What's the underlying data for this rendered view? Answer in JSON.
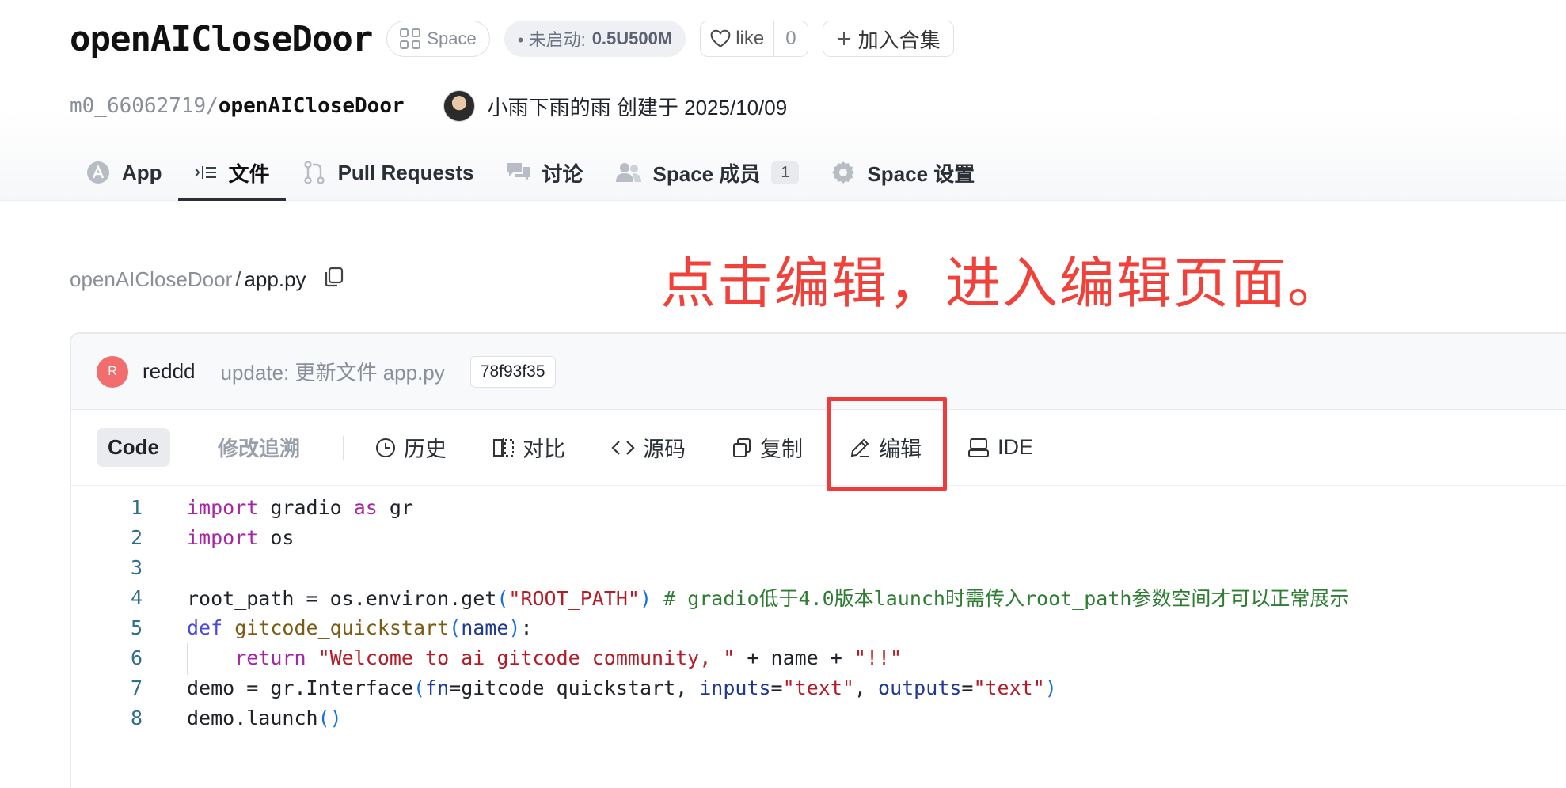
{
  "header": {
    "title": "openAICloseDoor",
    "space_label": "Space",
    "status_prefix": "• 未启动: ",
    "status_value": "0.5U500M",
    "like_label": "like",
    "like_count": "0",
    "collect_label": "加入合集",
    "owner": "m0_66062719/",
    "repo_name": "openAICloseDoor",
    "creator_text": "小雨下雨的雨 创建于 2025/10/09"
  },
  "tabs": [
    {
      "label": "App",
      "icon": "app-icon"
    },
    {
      "label": "文件",
      "icon": "files-icon"
    },
    {
      "label": "Pull Requests",
      "icon": "pull-request-icon"
    },
    {
      "label": "讨论",
      "icon": "discussion-icon"
    },
    {
      "label": "Space 成员",
      "icon": "members-icon",
      "count": "1"
    },
    {
      "label": "Space 设置",
      "icon": "settings-gear-icon"
    }
  ],
  "path": {
    "dir": "openAICloseDoor",
    "sep": "/",
    "file": "app.py"
  },
  "annotation": "点击编辑，进入编辑页面。",
  "commit": {
    "avatar_letter": "R",
    "author": "reddd",
    "message": "update: 更新文件 app.py",
    "hash": "78f93f35"
  },
  "toolbar": {
    "code_label": "Code",
    "blame_label": "修改追溯",
    "history_label": "历史",
    "compare_label": "对比",
    "raw_label": "源码",
    "copy_label": "复制",
    "edit_label": "编辑",
    "ide_label": "IDE"
  },
  "code": {
    "line_numbers": [
      "1",
      "2",
      "3",
      "4",
      "5",
      "6",
      "7",
      "8"
    ],
    "l1": {
      "a": "import",
      "b": " gradio ",
      "c": "as",
      "d": " gr"
    },
    "l2": {
      "a": "import",
      "b": " os"
    },
    "l4": {
      "a": "root_path = os.environ.get",
      "b": "(",
      "c": "\"ROOT_PATH\"",
      "d": ")",
      "e": " # gradio低于4.0版本launch时需传入root_path参数空间才可以正常展示"
    },
    "l5": {
      "a": "def",
      "b": " gitcode_quickstart",
      "c": "(",
      "d": "name",
      "e": ")",
      "f": ":"
    },
    "l6": {
      "a": "    return",
      "b": " \"Welcome to ai gitcode community, \"",
      "c": " + name + ",
      "d": "\"!!\""
    },
    "l7": {
      "a": "demo = gr.Interface",
      "b": "(",
      "c": "fn",
      "d": "=gitcode_quickstart, ",
      "e": "inputs",
      "f": "=",
      "g": "\"text\"",
      "h": ", ",
      "i": "outputs",
      "j": "=",
      "k": "\"text\"",
      "l": ")"
    },
    "l8": {
      "a": "demo.launch",
      "b": "()"
    }
  },
  "colors": {
    "annotation_red": "#f0423a",
    "highlight_border": "#ef3b3b"
  }
}
